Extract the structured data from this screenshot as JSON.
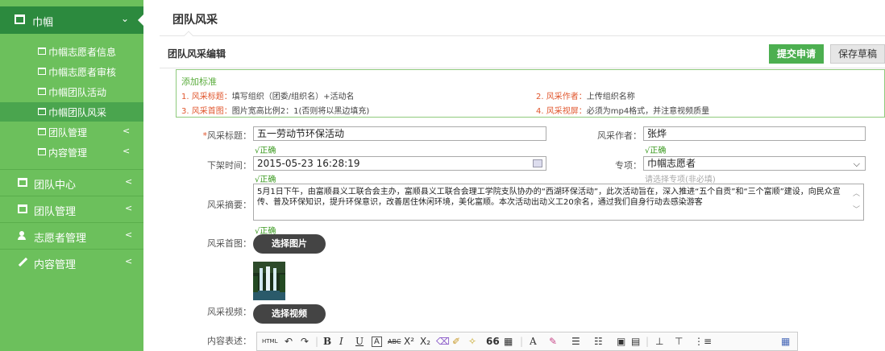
{
  "sidebar": {
    "head": {
      "label": "巾帼"
    },
    "sub_items": [
      {
        "label": "巾帼志愿者信息"
      },
      {
        "label": "巾帼志愿者审核"
      },
      {
        "label": "巾帼团队活动"
      },
      {
        "label": "巾帼团队风采"
      },
      {
        "label": "团队管理"
      },
      {
        "label": "内容管理"
      }
    ],
    "main_items": [
      {
        "label": "团队中心"
      },
      {
        "label": "团队管理"
      },
      {
        "label": "志愿者管理"
      },
      {
        "label": "内容管理"
      }
    ],
    "chevron": "<",
    "chevron_down": "⌄"
  },
  "header": {
    "title": "团队风采"
  },
  "section": {
    "title": "团队风采编辑",
    "submit_label": "提交申请",
    "draft_label": "保存草稿"
  },
  "standards": {
    "title": "添加标准",
    "items": [
      {
        "key": "1. 风采标题：",
        "text": "填写组织（团委/组织名）+活动名"
      },
      {
        "key": "2. 风采作者：",
        "text": "上传组织名称"
      },
      {
        "key": "3. 风采首图：",
        "text": "图片宽高比例2：1(否则将以黑边填充)"
      },
      {
        "key": "4. 风采视屏：",
        "text": "必须为mp4格式，并注意视频质量"
      }
    ]
  },
  "form": {
    "title_label_req": "*",
    "title_label": "风采标题：",
    "title_value": "五一劳动节环保活动",
    "author_label": "风采作者：",
    "author_value": "张烨",
    "ok_text": "√正确",
    "offline_label": "下架时间：",
    "offline_value": "2015-05-23 16:28:19",
    "topic_label": "专项：",
    "topic_value": "巾帼志愿者",
    "topic_hint": "请选择专项(非必填)",
    "summary_label": "风采摘要：",
    "summary_value": "5月1日下午，由富顺县义工联合会主办，富顺县义工联合会理工学院支队协办的“西湖环保活动”，此次活动旨在，深入推进“五个自贡”和“三个富顺”建设，向民众宣传、普及环保知识，提升环保意识，改善居住休闲环境，美化富顺。本次活动出动义工20余名，通过我们自身行动去感染游客",
    "cover_label": "风采首图：",
    "cover_button": "选择图片",
    "video_label": "风采视频：",
    "video_button": "选择视频",
    "content_label": "内容表述："
  },
  "toolbar": {
    "items": [
      "HTML",
      "↶",
      "↷",
      "|",
      "B",
      "I",
      "U",
      "A",
      "ABC",
      "X²",
      "X₂",
      "⌫",
      "✐",
      "✧",
      "66",
      "▦",
      "|",
      "A",
      "✎",
      "☰",
      "☷",
      "▣",
      "▤",
      "|",
      "⊥",
      "⊤",
      "⋮≡"
    ]
  },
  "colors": {
    "sidebar_bg": "#6cc05c",
    "sidebar_active": "#2c8a3e",
    "submit_bg": "#4caf50",
    "ok_green": "#3a9a1f",
    "req_red": "#e0562d"
  }
}
